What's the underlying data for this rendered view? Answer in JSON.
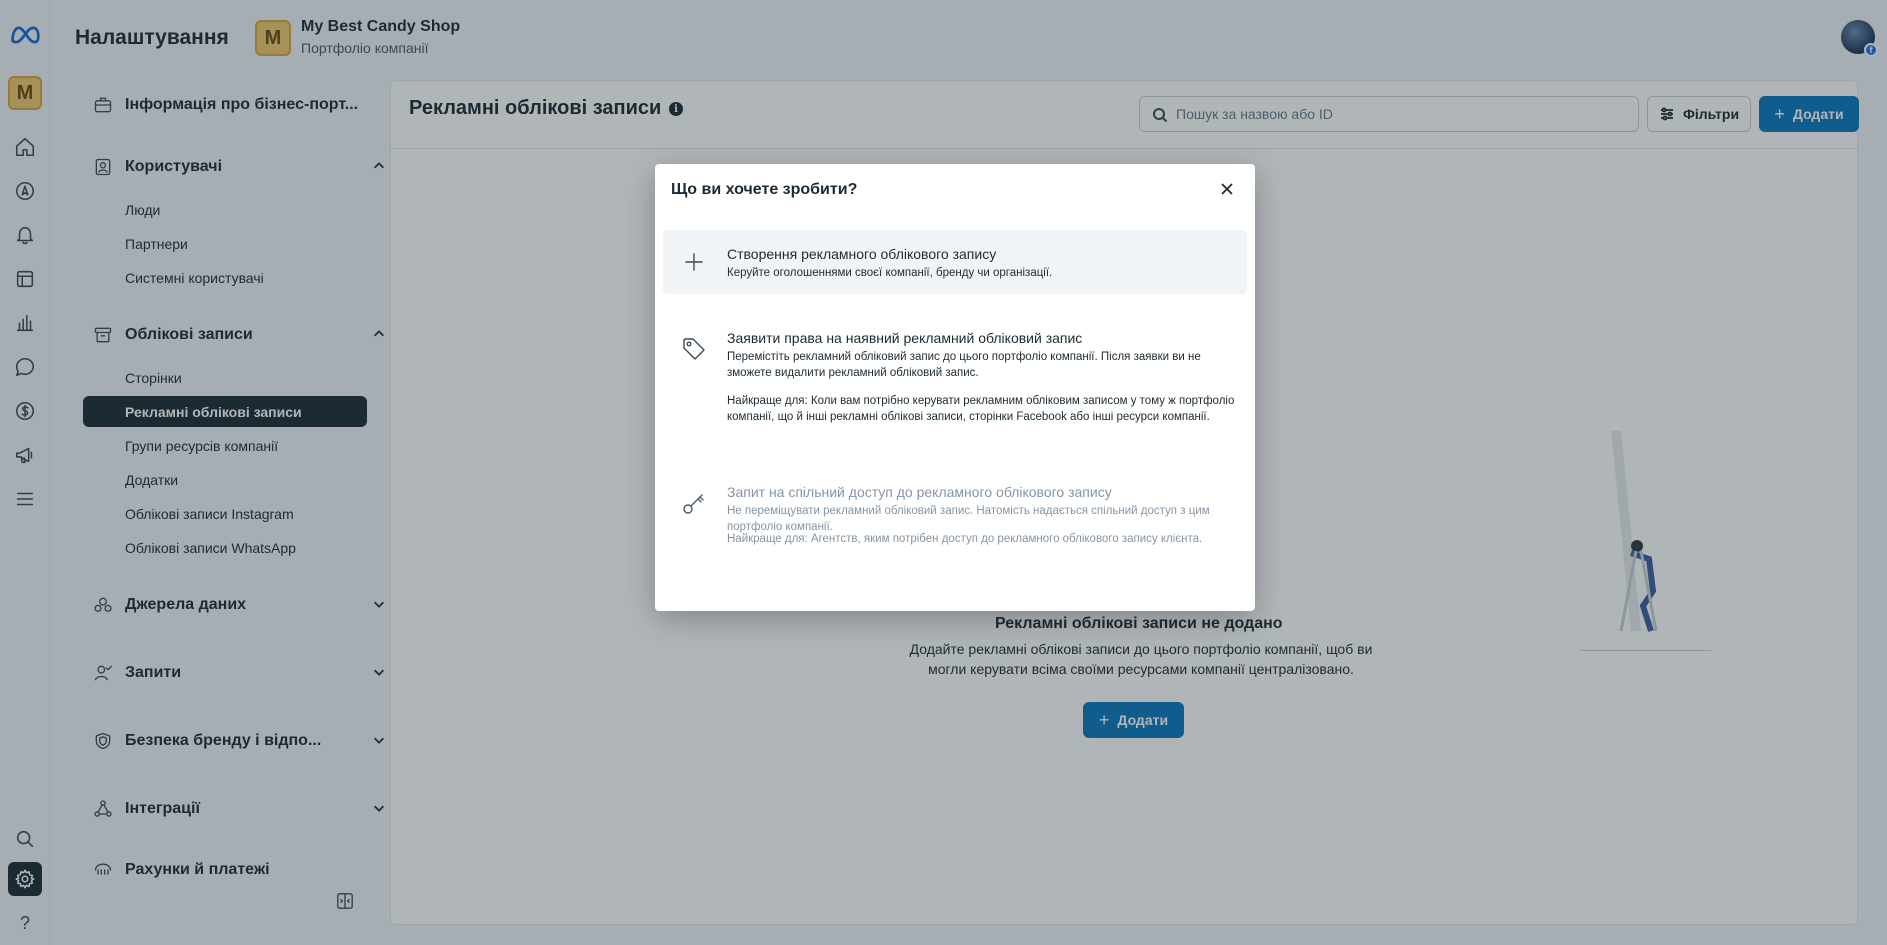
{
  "header": {
    "title": "Налаштування",
    "business_initial": "M",
    "business_name": "My Best Candy Shop",
    "business_subtitle": "Портфоліо компанії",
    "user_badge": "f"
  },
  "rail": {
    "business_initial": "M",
    "help_label": "?"
  },
  "sidebar": {
    "business_info": "Інформація про бізнес-порт...",
    "users": {
      "label": "Користувачі",
      "items": [
        "Люди",
        "Партнери",
        "Системні користувачі"
      ]
    },
    "accounts": {
      "label": "Облікові записи",
      "items": [
        "Сторінки",
        "Рекламні облікові записи",
        "Групи ресурсів компанії",
        "Додатки",
        "Облікові записи Instagram",
        "Облікові записи WhatsApp"
      ]
    },
    "data_sources": "Джерела даних",
    "requests": "Запити",
    "brand_safety": "Безпека бренду і відпо...",
    "integrations": "Інтеграції",
    "billing": "Рахунки й платежі"
  },
  "main": {
    "title": "Рекламні облікові записи",
    "info_glyph": "i",
    "search_placeholder": "Пошук за назвою або ID",
    "filters_label": "Фільтри",
    "add_label": "Додати",
    "empty_title": "Рекламні облікові записи не додано",
    "empty_desc": "Додайте рекламні облікові записи до цього портфоліо компанії, щоб ви могли керувати всіма своїми ресурсами компанії централізовано.",
    "empty_add_label": "Додати"
  },
  "modal": {
    "title": "Що ви хочете зробити?",
    "options": [
      {
        "title": "Створення рекламного облікового запису",
        "desc": "Керуйте оголошеннями своєї компанії, бренду чи організації."
      },
      {
        "title": "Заявити права на наявний рекламний обліковий запис",
        "desc": "Перемістіть рекламний обліковий запис до цього портфоліо компанії. Після заявки ви не зможете видалити рекламний обліковий запис.",
        "best_for": "Найкраще для: Коли вам потрібно керувати рекламним обліковим записом у тому ж портфоліо компанії, що й інші рекламні облікові записи, сторінки Facebook або інші ресурси компанії."
      },
      {
        "title": "Запит на спільний доступ до рекламного облікового запису",
        "desc": "Не переміщувати рекламний обліковий запис. Натомість надається спільний доступ з цим портфоліо компанії.",
        "best_for": "Найкраще для: Агентств, яким потрібен доступ до рекламного облікового запису клієнта."
      }
    ]
  },
  "colors": {
    "primary": "#0a78be",
    "dark": "#1c2b33",
    "business_avatar": "#f0c86c"
  }
}
